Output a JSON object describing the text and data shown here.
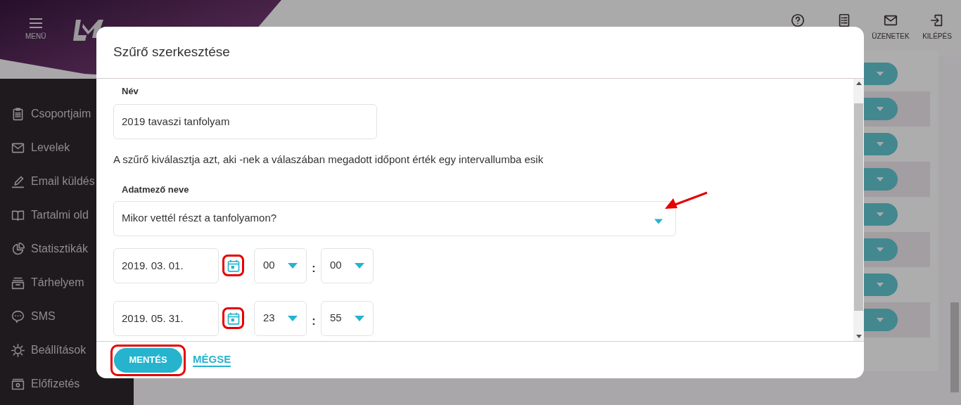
{
  "header": {
    "menu_label": "MENÜ",
    "actions": [
      {
        "kind": "help"
      },
      {
        "kind": "list"
      },
      {
        "kind": "mail",
        "label": "ÜZENETEK"
      },
      {
        "kind": "logout",
        "label": "KILÉPÉS"
      }
    ]
  },
  "sidebar": {
    "items": [
      {
        "kind": "clipboard",
        "label": "Csoportjaim"
      },
      {
        "kind": "mail",
        "label": "Levelek"
      },
      {
        "kind": "pen",
        "label": "Email küldés"
      },
      {
        "kind": "book",
        "label": "Tartalmi old"
      },
      {
        "kind": "pie",
        "label": "Statisztikák"
      },
      {
        "kind": "storage",
        "label": "Tárhelyem"
      },
      {
        "kind": "chat",
        "label": "SMS"
      },
      {
        "kind": "gear",
        "label": "Beállítások"
      },
      {
        "kind": "cash",
        "label": "Előfizetés"
      }
    ]
  },
  "background_rows": [
    {
      "shaded": false
    },
    {
      "shaded": true
    },
    {
      "shaded": false
    },
    {
      "shaded": true
    },
    {
      "shaded": false
    },
    {
      "shaded": true
    },
    {
      "shaded": false
    },
    {
      "shaded": true
    }
  ],
  "dialog": {
    "title": "Szűrő szerkesztése",
    "name_field": {
      "label": "Név",
      "value": "2019 tavaszi tanfolyam"
    },
    "description": "A szűrő kiválasztja azt, aki -nek a válaszában megadott időpont érték egy intervallumba esik",
    "field_select": {
      "label": "Adatmező neve",
      "value": "Mikor vettél részt a tanfolyamon?",
      "annotated": true
    },
    "ranges": [
      {
        "date": "2019. 03. 01.",
        "hour": "00",
        "minute": "00",
        "separator": ":",
        "highlighted": true
      },
      {
        "date": "2019. 05. 31.",
        "hour": "23",
        "minute": "55",
        "separator": ":",
        "highlighted": true
      }
    ],
    "save": {
      "label": "MENTÉS",
      "highlighted": true
    },
    "cancel": {
      "label": "MÉGSE"
    }
  }
}
